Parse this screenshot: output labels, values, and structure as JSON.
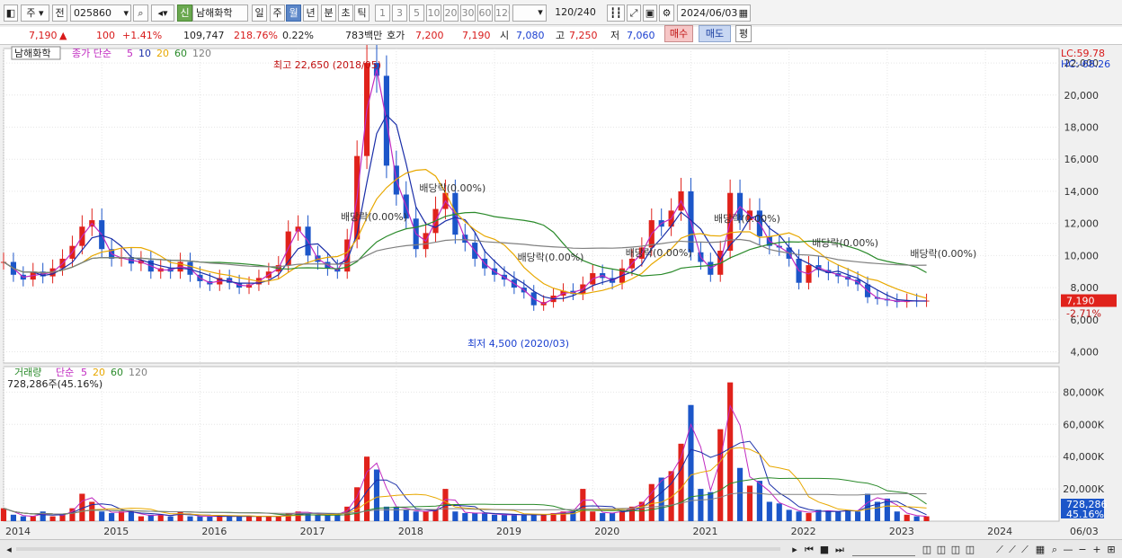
{
  "toolbar": {
    "period_sel": "주",
    "prev_label": "전",
    "code": "025860",
    "new_badge": "신",
    "stock_name": "남해화학",
    "tabs": [
      "일",
      "주",
      "월",
      "년",
      "분",
      "초",
      "틱"
    ],
    "active_tab": "월",
    "intervals": [
      "1",
      "3",
      "5",
      "10",
      "20",
      "30",
      "60",
      "120"
    ],
    "count": "120",
    "count_total": "/240",
    "date": "2024/06/03"
  },
  "quote": {
    "price": "7,190",
    "change": "100",
    "change_pct": "+1.41%",
    "volume": "109,747",
    "vol_ratio": "218.76%",
    "turnover_pct": "0.22%",
    "amount": "783백만",
    "hoga_label": "호가",
    "ask": "7,200",
    "bid": "7,190",
    "open_label": "시",
    "open": "7,080",
    "high_label": "고",
    "high": "7,250",
    "low_label": "저",
    "low": "7,060",
    "buy_label": "매수",
    "sell_label": "매도",
    "avg_label": "평"
  },
  "colors": {
    "up": "#e0221b",
    "down": "#1c56c9",
    "ma5": "#c02ac0",
    "ma10": "#1a2ea8",
    "ma20": "#e8a800",
    "ma60": "#2a8a2a",
    "ma120": "#808080"
  },
  "chart_data": [
    {
      "type": "candlestick",
      "title": "남해화학",
      "legend": [
        {
          "label": "종가 단순",
          "color": "#c02ac0"
        },
        {
          "label": "5",
          "color": "#c02ac0"
        },
        {
          "label": "10",
          "color": "#1a2ea8"
        },
        {
          "label": "20",
          "color": "#e8a800"
        },
        {
          "label": "60",
          "color": "#2a8a2a"
        },
        {
          "label": "120",
          "color": "#808080"
        }
      ],
      "corner_labels": [
        "LC:59.78",
        "HC:-68.26"
      ],
      "y_ticks": [
        "22,000",
        "20,000",
        "18,000",
        "16,000",
        "14,000",
        "12,000",
        "10,000",
        "8,000",
        "6,000",
        "4,000"
      ],
      "ylim": [
        3300,
        22900
      ],
      "x_ticks": [
        "2014",
        "2015",
        "2016",
        "2017",
        "2018",
        "2019",
        "2020",
        "2021",
        "2022",
        "2023",
        "2024",
        "06/03"
      ],
      "x_start": 2014.0,
      "x_end": 2024.75,
      "series": {
        "t": [
          2014.0,
          2014.1,
          2014.2,
          2014.3,
          2014.4,
          2014.5,
          2014.6,
          2014.7,
          2014.8,
          2014.9,
          2015.0,
          2015.1,
          2015.2,
          2015.3,
          2015.4,
          2015.5,
          2015.6,
          2015.7,
          2015.8,
          2015.9,
          2016.0,
          2016.1,
          2016.2,
          2016.3,
          2016.4,
          2016.5,
          2016.6,
          2016.7,
          2016.8,
          2016.9,
          2017.0,
          2017.1,
          2017.2,
          2017.3,
          2017.4,
          2017.5,
          2017.6,
          2017.7,
          2017.8,
          2017.9,
          2018.0,
          2018.1,
          2018.2,
          2018.3,
          2018.4,
          2018.5,
          2018.6,
          2018.7,
          2018.8,
          2018.9,
          2019.0,
          2019.1,
          2019.2,
          2019.3,
          2019.4,
          2019.5,
          2019.6,
          2019.7,
          2019.8,
          2019.9,
          2020.0,
          2020.1,
          2020.2,
          2020.3,
          2020.4,
          2020.5,
          2020.6,
          2020.7,
          2020.8,
          2020.9,
          2021.0,
          2021.1,
          2021.2,
          2021.3,
          2021.4,
          2021.5,
          2021.6,
          2021.7,
          2021.8,
          2021.9,
          2022.0,
          2022.1,
          2022.2,
          2022.3,
          2022.4,
          2022.5,
          2022.6,
          2022.7,
          2022.8,
          2022.9,
          2023.0,
          2023.1,
          2023.2,
          2023.3,
          2023.4,
          2023.5,
          2023.6,
          2023.7,
          2023.8,
          2023.9,
          2024.0,
          2024.1,
          2024.2,
          2024.3,
          2024.4
        ],
        "close": [
          9600,
          8800,
          8500,
          9000,
          8700,
          9200,
          9800,
          10600,
          11800,
          12200,
          10400,
          9800,
          9900,
          9500,
          9700,
          9000,
          9200,
          9000,
          9600,
          8800,
          8400,
          8200,
          8600,
          8300,
          8000,
          8200,
          8600,
          9000,
          9400,
          11500,
          11800,
          10000,
          9600,
          9200,
          9000,
          11000,
          16200,
          22000,
          21200,
          15600,
          13800,
          12300,
          10400,
          11400,
          12900,
          13900,
          11300,
          10800,
          9800,
          9200,
          8800,
          8500,
          8000,
          7700,
          6900,
          7100,
          7500,
          7800,
          7600,
          8200,
          8900,
          8600,
          8300,
          9200,
          9800,
          10500,
          12200,
          11800,
          12800,
          14000,
          10200,
          9600,
          8800,
          10300,
          13900,
          12200,
          12800,
          11200,
          10600,
          10500,
          9800,
          8300,
          9400,
          9100,
          8900,
          8700,
          8500,
          8200,
          7400,
          7300,
          7200,
          7100,
          7200,
          7150,
          7190
        ],
        "vol": [
          8,
          4,
          3,
          3,
          6,
          3,
          4,
          8,
          17,
          12,
          6,
          5,
          6,
          6,
          3,
          4,
          4,
          3,
          6,
          3,
          3,
          3,
          3,
          3,
          3,
          3,
          3,
          3,
          3,
          5,
          6,
          5,
          4,
          4,
          4,
          9,
          21,
          40,
          32,
          9,
          9,
          7,
          6,
          6,
          7,
          20,
          6,
          5,
          5,
          5,
          4,
          4,
          4,
          4,
          4,
          4,
          5,
          6,
          6,
          20,
          6,
          5,
          5,
          7,
          9,
          12,
          23,
          27,
          31,
          48,
          72,
          20,
          18,
          57,
          86,
          33,
          22,
          25,
          12,
          11,
          7,
          6,
          5,
          7,
          6,
          6,
          7,
          6,
          17,
          12,
          14,
          6,
          4,
          3,
          3
        ]
      }
    },
    {
      "type": "bar",
      "title": "거래량",
      "legend": [
        {
          "label": "단순",
          "color": "#c02ac0"
        },
        {
          "label": "5",
          "color": "#c02ac0"
        },
        {
          "label": "20",
          "color": "#e8a800"
        },
        {
          "label": "60",
          "color": "#2a8a2a"
        },
        {
          "label": "120",
          "color": "#808080"
        }
      ],
      "sub_label": "728,286주(45.16%)",
      "y_ticks": [
        "80,000K",
        "60,000K",
        "40,000K",
        "20,000K"
      ],
      "ylim": [
        0,
        88000
      ],
      "tag_value": "728,286",
      "tag_pct": "45.16%"
    }
  ],
  "annotations": {
    "high": "최고 22,650 (2018/05)",
    "low": "최저 4,500 (2020/03)",
    "dividends": [
      "배당락(0.00%)",
      "배당락(0.00%)",
      "배당락(0.00%)",
      "배당락(0.00%)",
      "배당락(0.00%)",
      "배당락(0.00%)",
      "배당락(0.00%)"
    ],
    "price_tag": "7,190",
    "price_tag_pct": "-2.71%"
  }
}
